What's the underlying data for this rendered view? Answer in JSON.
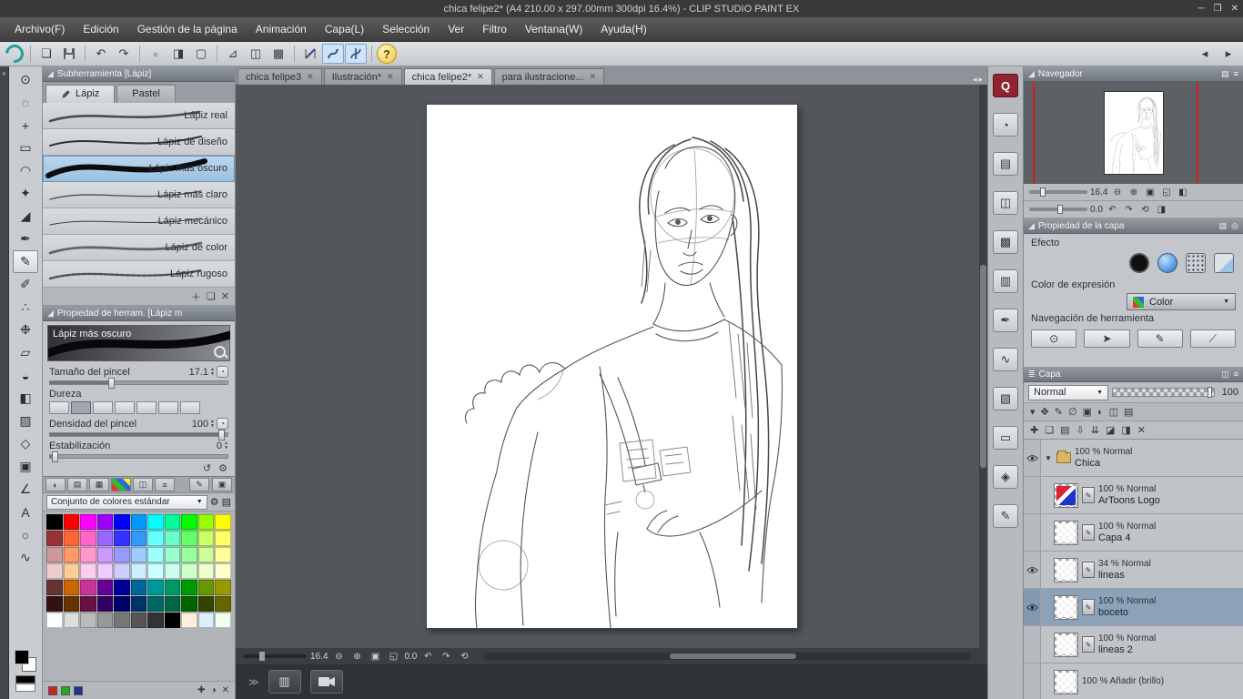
{
  "window": {
    "title": "chica felipe2* (A4 210.00 x 297.00mm 300dpi 16.4%)  - CLIP STUDIO PAINT EX"
  },
  "menu": [
    "Archivo(F)",
    "Edición",
    "Gestión de la página",
    "Animación",
    "Capa(L)",
    "Selección",
    "Ver",
    "Filtro",
    "Ventana(W)",
    "Ayuda(H)"
  ],
  "toolbar": {
    "help_label": "?"
  },
  "doc_tabs": [
    "chica felipe3",
    "Ilustración*",
    "chica felipe2*",
    "para ilustracione..."
  ],
  "tools": [
    {
      "name": "zoom-tool",
      "glyph": "⊙"
    },
    {
      "name": "object-tool",
      "glyph": "◌"
    },
    {
      "name": "move-tool",
      "glyph": "+"
    },
    {
      "name": "selection-tool",
      "glyph": "▭"
    },
    {
      "name": "lasso-tool",
      "glyph": "◠"
    },
    {
      "name": "wand-tool",
      "glyph": "✦"
    },
    {
      "name": "eyedropper-tool",
      "glyph": "◢"
    },
    {
      "name": "pen-tool",
      "glyph": "✒"
    },
    {
      "name": "pencil-tool",
      "glyph": "✎",
      "selected": true
    },
    {
      "name": "brush-tool",
      "glyph": "✐"
    },
    {
      "name": "airbrush-tool",
      "glyph": "∴"
    },
    {
      "name": "decoration-tool",
      "glyph": "❉"
    },
    {
      "name": "eraser-tool",
      "glyph": "▱"
    },
    {
      "name": "blend-tool",
      "glyph": "◒"
    },
    {
      "name": "fill-tool",
      "glyph": "◧"
    },
    {
      "name": "gradient-tool",
      "glyph": "▨"
    },
    {
      "name": "figure-tool",
      "glyph": "◇"
    },
    {
      "name": "frame-tool",
      "glyph": "▣"
    },
    {
      "name": "ruler-tool",
      "glyph": "∠"
    },
    {
      "name": "text-tool",
      "glyph": "A"
    },
    {
      "name": "balloon-tool",
      "glyph": "○"
    },
    {
      "name": "line-correction-tool",
      "glyph": "∿"
    }
  ],
  "dock_icons": [
    {
      "name": "dock-quick-access",
      "glyph": "Q"
    },
    {
      "name": "dock-material-characters",
      "glyph": "◔"
    },
    {
      "name": "dock-material-folder",
      "glyph": "▤"
    },
    {
      "name": "dock-material-close",
      "glyph": "◫"
    },
    {
      "name": "dock-material-pattern",
      "glyph": "▩"
    },
    {
      "name": "dock-material-list",
      "glyph": "▥"
    },
    {
      "name": "dock-material-pen",
      "glyph": "✒"
    },
    {
      "name": "dock-material-stroke",
      "glyph": "∿"
    },
    {
      "name": "dock-material-image",
      "glyph": "▧"
    },
    {
      "name": "dock-material-canvas",
      "glyph": "▭"
    },
    {
      "name": "dock-material-3d",
      "glyph": "◈"
    },
    {
      "name": "dock-material-brush",
      "glyph": "✎"
    }
  ],
  "subtool": {
    "title": "Subherramienta [Lápiz]",
    "tabs": [
      "Lápiz",
      "Pastel"
    ],
    "items": [
      "Lápiz real",
      "Lápiz de diseño",
      "Lápiz más oscuro",
      "Lápiz más claro",
      "Lápiz mecánico",
      "Lápiz de color",
      "Lápiz rugoso"
    ],
    "selected_index": 2
  },
  "tool_property": {
    "title": "Propiedad de herram. [Lápiz m",
    "brush_name": "Lápiz más oscuro",
    "controls": [
      {
        "label": "Tamaño del pincel",
        "value": "17.1"
      },
      {
        "label": "Dureza",
        "value": ""
      },
      {
        "label": "Densidad del pincel",
        "value": "100"
      },
      {
        "label": "Estabilización",
        "value": "0"
      }
    ]
  },
  "color_panel": {
    "set_name": "Conjunto de colores estándar",
    "palette": [
      "#000000",
      "#ff0000",
      "#ff00ff",
      "#9900ff",
      "#0000ff",
      "#0099ff",
      "#00ffff",
      "#00ff99",
      "#00ff00",
      "#99ff00",
      "#ffff00",
      "#993333",
      "#ff6633",
      "#ff66cc",
      "#9966ff",
      "#3333ff",
      "#3399ff",
      "#66ffff",
      "#66ffcc",
      "#66ff66",
      "#ccff66",
      "#ffff66",
      "#cc9999",
      "#ff9966",
      "#ff99cc",
      "#cc99ff",
      "#9999ff",
      "#99ccff",
      "#99ffff",
      "#99ffcc",
      "#99ff99",
      "#ccff99",
      "#ffff99",
      "#eecccc",
      "#ffcc99",
      "#ffccee",
      "#eeccff",
      "#ccccff",
      "#cceeff",
      "#ccffff",
      "#ccffee",
      "#ccffcc",
      "#eeffcc",
      "#ffffcc",
      "#663333",
      "#cc6600",
      "#cc3399",
      "#660099",
      "#000099",
      "#006699",
      "#009999",
      "#009966",
      "#009900",
      "#669900",
      "#999900",
      "#331111",
      "#663300",
      "#661144",
      "#330066",
      "#000066",
      "#003366",
      "#006666",
      "#006644",
      "#006600",
      "#334400",
      "#666600",
      "#ffffff",
      "#dddddd",
      "#bbbbbb",
      "#999999",
      "#777777",
      "#555555",
      "#333333",
      "#000000",
      "#ffeedd",
      "#ddeeff",
      "#eeffee"
    ],
    "recent": [
      "#cc2222",
      "#22aa22",
      "#223388"
    ]
  },
  "canvas_bar": {
    "zoom": "16.4",
    "rotation": "0.0"
  },
  "navigator": {
    "title": "Navegador",
    "zoom": "16.4",
    "rotation": "0.0"
  },
  "layer_property": {
    "title": "Propiedad de la capa",
    "effect_label": "Efecto",
    "expression_label": "Color de expresión",
    "expression_value": "Color",
    "nav_label": "Navegación de herramienta"
  },
  "layers": {
    "title": "Capa",
    "blend_mode": "Normal",
    "opacity": "100",
    "items": [
      {
        "op": "100 % Normal",
        "name": "Chica",
        "type": "folder",
        "visible": true
      },
      {
        "op": "100 % Normal",
        "name": "ArToons Logo",
        "visible": false
      },
      {
        "op": "100 % Normal",
        "name": "Capa 4",
        "visible": false
      },
      {
        "op": "34 % Normal",
        "name": "lineas",
        "visible": true
      },
      {
        "op": "100 % Normal",
        "name": "boceto",
        "visible": true,
        "selected": true
      },
      {
        "op": "100 % Normal",
        "name": "lineas 2",
        "visible": false
      },
      {
        "op": "100 % Añadir (brillo)",
        "name": "",
        "visible": false
      }
    ]
  }
}
